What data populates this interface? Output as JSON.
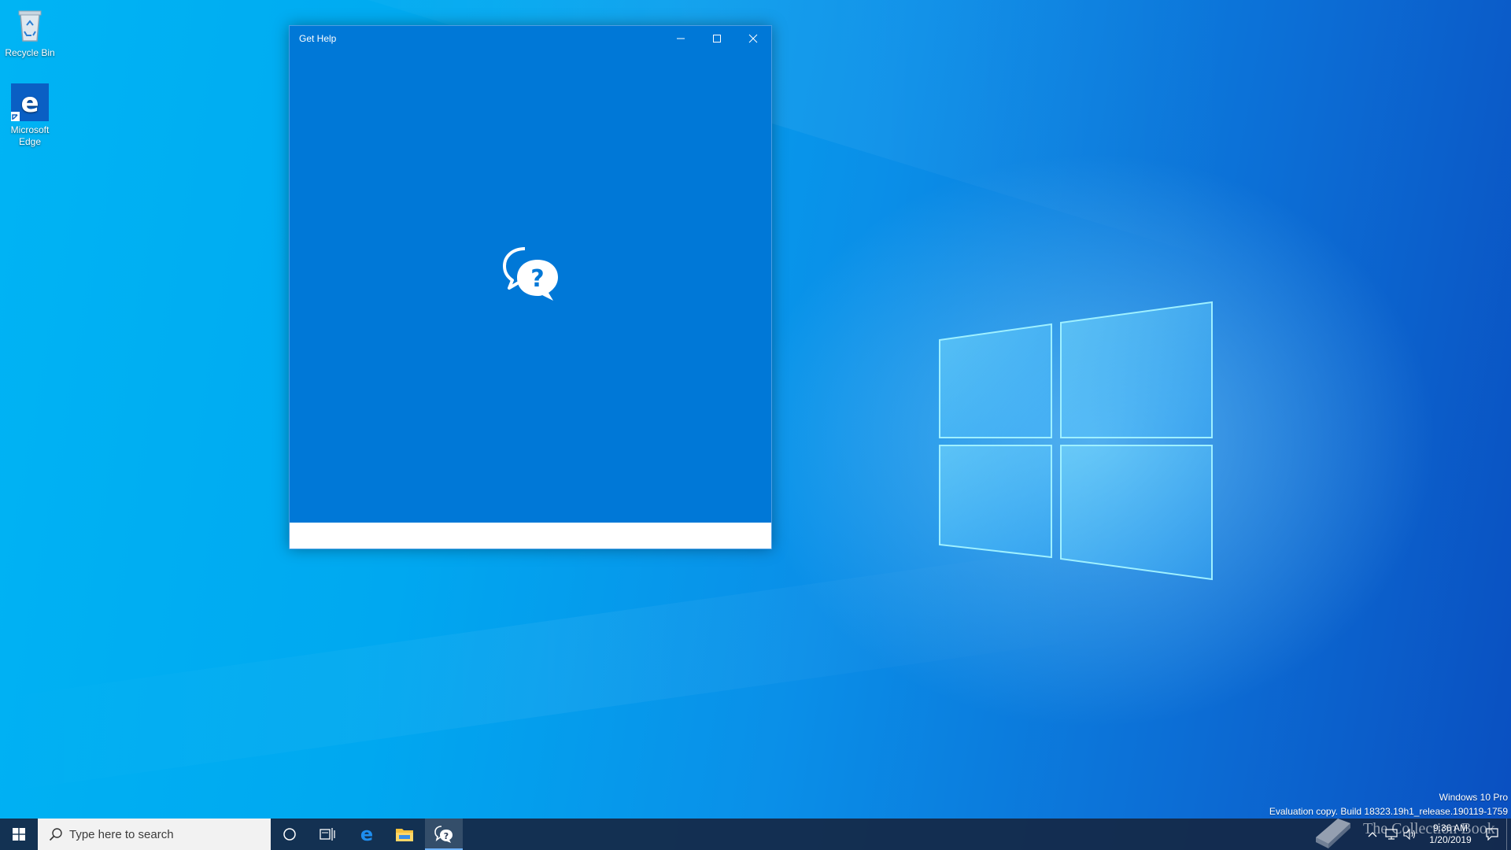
{
  "desktop": {
    "icons": [
      {
        "label": "Recycle Bin"
      },
      {
        "label": "Microsoft Edge"
      }
    ],
    "watermark": {
      "line1": "Windows 10 Pro",
      "line2": "Evaluation copy. Build 18323.19h1_release.190119-1759"
    },
    "overlay_mark": "The Collection Book"
  },
  "window": {
    "title": "Get Help",
    "accent": "#0078d7",
    "controls": {
      "minimize": "minimize-icon",
      "maximize": "maximize-icon",
      "close": "close-icon"
    },
    "splash_icon": "chat-help-icon"
  },
  "taskbar": {
    "search": {
      "placeholder": "Type here to search"
    },
    "pinned": [
      {
        "icon": "cortana-icon"
      },
      {
        "icon": "task-view-icon"
      },
      {
        "icon": "edge-icon"
      },
      {
        "icon": "file-explorer-icon"
      },
      {
        "icon": "get-help-icon",
        "active": true
      }
    ],
    "tray": {
      "time": "9:36 AM",
      "date": "1/20/2019"
    }
  }
}
